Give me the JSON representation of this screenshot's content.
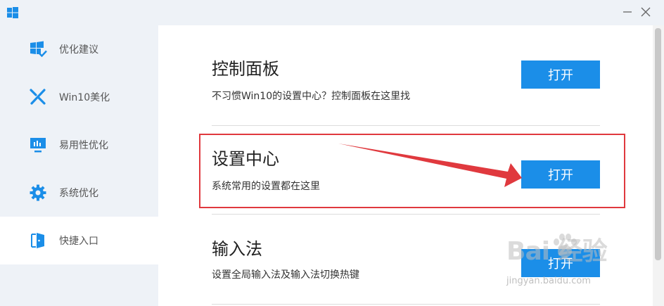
{
  "window": {
    "minimize_glyph": "—",
    "close_glyph": "✕"
  },
  "sidebar": {
    "items": [
      {
        "label": "优化建议",
        "icon": "windows-check-icon",
        "active": false
      },
      {
        "label": "Win10美化",
        "icon": "brush-icon",
        "active": false
      },
      {
        "label": "易用性优化",
        "icon": "monitor-icon",
        "active": false
      },
      {
        "label": "系统优化",
        "icon": "gear-icon",
        "active": false
      },
      {
        "label": "快捷入口",
        "icon": "door-icon",
        "active": true
      }
    ]
  },
  "sections": [
    {
      "title": "控制面板",
      "desc": "不习惯Win10的设置中心？控制面板在这里找",
      "button": "打开"
    },
    {
      "title": "设置中心",
      "desc": "系统常用的设置都在这里",
      "button": "打开"
    },
    {
      "title": "输入法",
      "desc": "设置全局输入法及输入法切换热键",
      "button": "打开"
    }
  ],
  "watermark": {
    "main": "Bai  经验",
    "sub": "jingyan.baidu.com"
  },
  "colors": {
    "accent": "#1b8ee8",
    "sidebar_bg": "#eef2f7",
    "highlight": "#e0393e",
    "icon_blue": "#1b8ee8"
  }
}
